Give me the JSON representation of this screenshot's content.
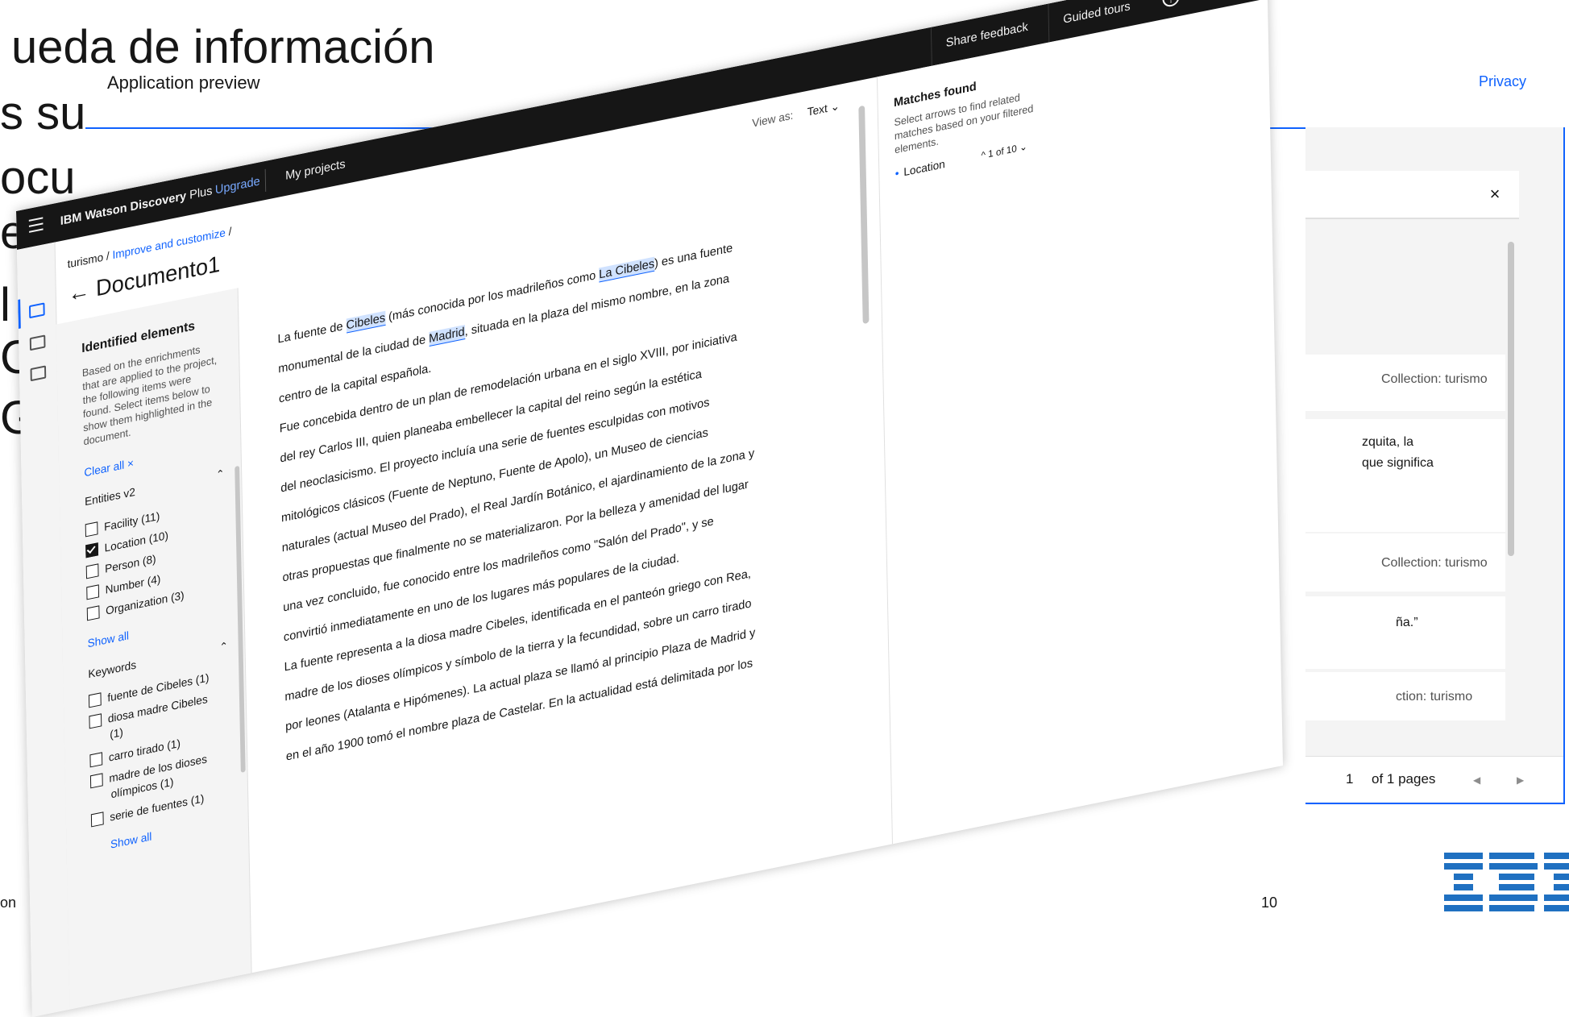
{
  "slide": {
    "title_lines": [
      "ueda de información",
      "s su",
      "ocu",
      "e",
      "l",
      "C",
      "G"
    ],
    "footer_left": "on",
    "page_number": "10",
    "logo_text": "IBM"
  },
  "preview": {
    "title": "Application preview",
    "privacy": "Privacy",
    "close": "×",
    "cards": [
      {
        "text": "Collection: turismo"
      },
      {
        "text": "zquita, la"
      },
      {
        "text": "que significa"
      },
      {
        "text": "Collection: turismo"
      },
      {
        "text": "ña.”"
      },
      {
        "text": "ction: turismo"
      }
    ],
    "pager": {
      "page": "1",
      "of": "of 1 pages",
      "prev": "◀",
      "next": "▶"
    }
  },
  "app": {
    "brand": "IBM Watson Discovery",
    "brand_suffix": "Plus",
    "upgrade": "Upgrade",
    "my_projects": "My projects",
    "share_feedback": "Share feedback",
    "guided_tours": "Guided tours",
    "help_icon": "?",
    "user_icon": "☺",
    "breadcrumb": {
      "root": "turismo",
      "sep": "/",
      "link": "Improve and customize",
      "sep2": "/"
    },
    "doc_title": "← Documento1",
    "left": {
      "heading": "Identified elements",
      "description": "Based on the enrichments that are applied to the project, the following items were found. Select items below to show them highlighted in the document.",
      "clear_all": "Clear all  ×",
      "entities_heading": "Entities v2",
      "entities": [
        {
          "label": "Facility (11)",
          "checked": false
        },
        {
          "label": "Location (10)",
          "checked": true
        },
        {
          "label": "Person (8)",
          "checked": false
        },
        {
          "label": "Number (4)",
          "checked": false
        },
        {
          "label": "Organization (3)",
          "checked": false
        }
      ],
      "show_all": "Show all",
      "keywords_heading": "Keywords",
      "keywords": [
        {
          "label": "fuente de Cibeles (1)",
          "checked": false
        },
        {
          "label": "diosa madre Cibeles",
          "label2": "(1)",
          "checked": false
        },
        {
          "label": "carro tirado (1)",
          "checked": false
        },
        {
          "label": "madre de los dioses",
          "label2": "olímpicos (1)",
          "checked": false
        },
        {
          "label": "serie de fuentes (1)",
          "checked": false
        }
      ],
      "show_all_2": "Show all"
    },
    "view_as_label": "View as:",
    "view_as_value": "Text  ⌄",
    "document_lines": [
      [
        "La fuente de ",
        "Cibeles",
        " (más conocida por los madrileños como ",
        "La Cibeles",
        ") es una fuente"
      ],
      [
        "monumental de la ciudad de ",
        "Madrid",
        ", situada en la plaza del mismo nombre, en la zona"
      ],
      [
        "centro de la capital española."
      ],
      [
        "Fue concebida dentro de un plan de remodelación urbana en el siglo XVIII, por iniciativa"
      ],
      [
        "del rey Carlos III, quien planeaba embellecer la capital del reino según la estética"
      ],
      [
        "del neoclasicismo. El proyecto incluía una serie de fuentes esculpidas con motivos"
      ],
      [
        "mitológicos clásicos (Fuente de Neptuno, Fuente de Apolo), un Museo de ciencias"
      ],
      [
        "naturales (actual Museo del Prado), el Real Jardín Botánico, el ajardinamiento de la zona y"
      ],
      [
        "otras propuestas que finalmente no se materializaron. Por la belleza y amenidad del lugar"
      ],
      [
        "una vez concluido, fue conocido entre los madrileños como \"Salón del Prado\", y se"
      ],
      [
        "convirtió inmediatamente en uno de los lugares más populares de la ciudad."
      ],
      [
        "La fuente representa a la diosa madre Cibeles, identificada en el panteón griego con Rea,"
      ],
      [
        "madre de los dioses olímpicos y símbolo de la tierra y la fecundidad, sobre un carro tirado"
      ],
      [
        "por leones (Atalanta e Hipómenes). La actual plaza se llamó al principio Plaza de Madrid y"
      ],
      [
        "en el año 1900 tomó el nombre plaza de Castelar. En la actualidad está delimitada por los"
      ]
    ],
    "right": {
      "heading": "Matches found",
      "description": "Select arrows to find related matches based on your filtered elements.",
      "location": "Location",
      "counter": "^  1 of 10  ⌄"
    }
  }
}
